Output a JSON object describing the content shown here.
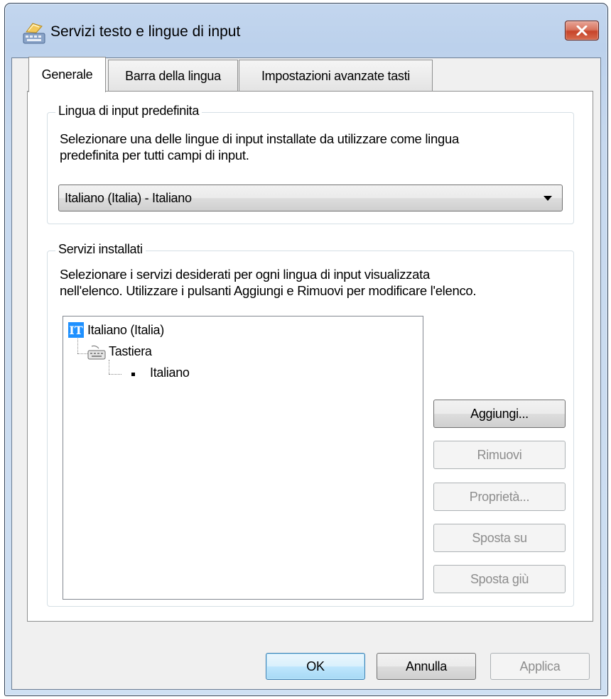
{
  "window": {
    "title": "Servizi testo e lingue di input"
  },
  "tabs": [
    {
      "label": "Generale",
      "active": true
    },
    {
      "label": "Barra della lingua",
      "active": false
    },
    {
      "label": "Impostazioni avanzate tasti",
      "active": false
    }
  ],
  "default_language": {
    "legend": "Lingua di input predefinita",
    "description_line1": "Selezionare una delle lingue di input installate da utilizzare come lingua",
    "description_line2": "predefinita per tutti campi di input.",
    "selected": "Italiano (Italia) - Italiano"
  },
  "installed_services": {
    "legend": "Servizi installati",
    "description_line1": "Selezionare i servizi desiderati per ogni lingua di input visualizzata",
    "description_line2": "nell'elenco. Utilizzare i pulsanti Aggiungi e Rimuovi per modificare l'elenco.",
    "tree": {
      "language_badge": "IT",
      "language": "Italiano (Italia)",
      "category": "Tastiera",
      "service": "Italiano"
    },
    "buttons": {
      "add": "Aggiungi...",
      "remove": "Rimuovi",
      "properties": "Proprietà...",
      "move_up": "Sposta su",
      "move_down": "Sposta giù"
    }
  },
  "footer": {
    "ok": "OK",
    "cancel": "Annulla",
    "apply": "Applica"
  },
  "icons": {
    "app": "text-services-icon",
    "close": "close-icon",
    "dropdown": "chevron-down-icon",
    "language": "language-badge-icon",
    "keyboard": "keyboard-icon"
  },
  "colors": {
    "close_button": "#c7442a",
    "language_badge": "#1e90ff",
    "default_button_border": "#3c7fb1"
  }
}
